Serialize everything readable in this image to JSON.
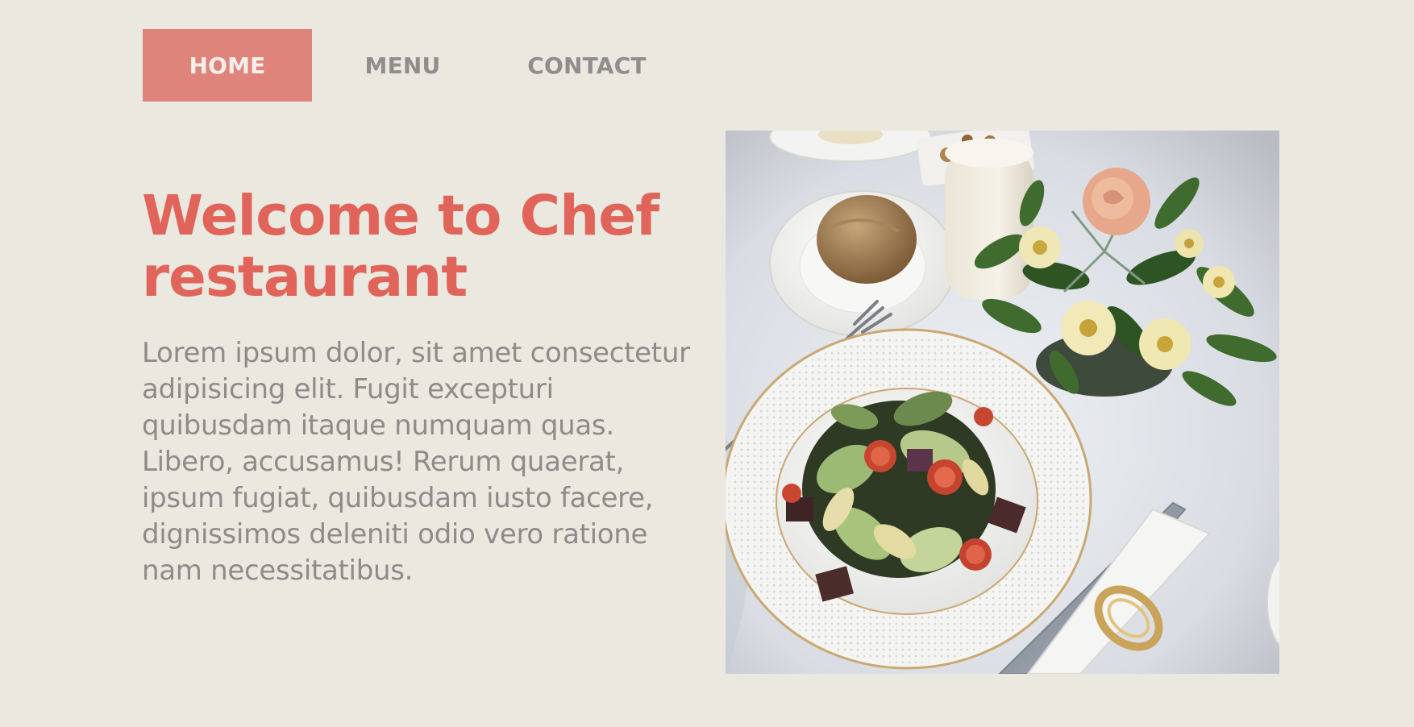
{
  "nav": {
    "items": [
      {
        "label": "HOME",
        "active": true
      },
      {
        "label": "MENU",
        "active": false
      },
      {
        "label": "CONTACT",
        "active": false
      }
    ]
  },
  "hero": {
    "title": "Welcome to Chef restaurant",
    "body": "Lorem ipsum dolor, sit amet consectetur adipisicing elit. Fugit excepturi quibusdam itaque numquam quas. Libero, accusamus! Rerum quaerat, ipsum fugiat, quibusdam iusto facere, dignissimos deleniti odio vero ratione nam necessitatibus.",
    "image": "photo of a salad plate on a table with bread, candle and flowers"
  },
  "colors": {
    "background": "#ebe8df",
    "accent": "#e0645a",
    "nav_active_bg": "#df847b",
    "nav_text": "#8f8e8c",
    "body_text": "#8d8c8a"
  }
}
